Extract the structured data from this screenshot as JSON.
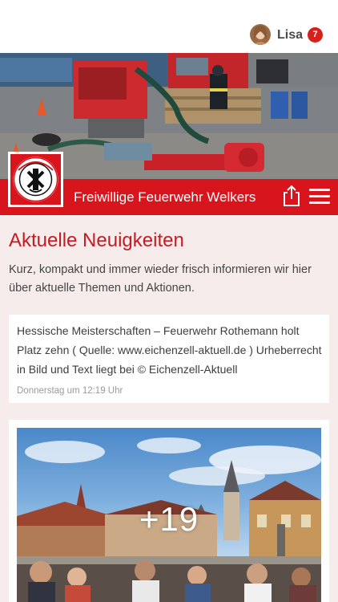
{
  "header": {
    "user_name": "Lisa",
    "notification_count": "7"
  },
  "brand": {
    "title": "Freiwillige Feuerwehr Welkers",
    "logo_text": "Freiwillige Feuerwehr Welkers",
    "accent_color": "#d8141d"
  },
  "news": {
    "heading": "Aktuelle Neuigkeiten",
    "description": "Kurz, kompakt und immer wieder frisch informieren wir hier über aktuelle Themen und Aktionen.",
    "items": [
      {
        "text": "Hessische Meisterschaften – Feuerwehr Rothemann holt Platz zehn ( Quelle: www.eichenzell-aktuell.de ) Urheberrecht in Bild und Text liegt bei © Eichenzell-Aktuell",
        "timestamp": "Donnerstag um 12:19 Uhr"
      }
    ],
    "gallery": {
      "more_count": "+19"
    }
  },
  "icons": {
    "share": "share-icon",
    "menu": "hamburger-menu-icon"
  }
}
